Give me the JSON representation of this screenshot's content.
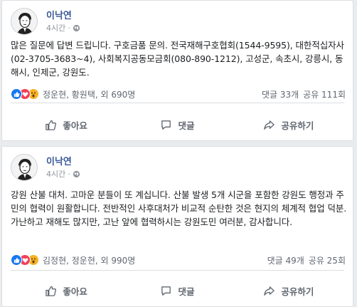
{
  "posts": [
    {
      "author": "이낙연",
      "time": "4시간",
      "text": "많은 질문에 답변 드립니다. 구호금품 문의. 전국재해구호협회(1544-9595), 대한적십자사(02-3705-3683~4), 사회복지공동모금회(080-890-1212), 고성군, 속초시, 강릉시, 동해시, 인제군, 강원도.",
      "reactors": "정운현, 황원택, 외 690명",
      "comments": "댓글 33개",
      "shares": "공유 111회"
    },
    {
      "author": "이낙연",
      "time": "4시간",
      "text": "강원 산불 대처. 고마운 분들이 또 계십니다. 산불 발생 5개 시군을 포함한 강원도 행정과 주민의 협력이 원활합니다. 전반적인 사후대처가 비교적 순탄한 것은 현지의 체계적 협업 덕분. 가난하고 재해도 많지만, 고난 앞에 협력하시는 강원도민 여러분, 감사합니다.",
      "reactors": "김정현, 정운현, 외 990명",
      "comments": "댓글 49개",
      "shares": "공유 25회"
    }
  ],
  "actions": {
    "like": "좋아요",
    "comment": "댓글",
    "share": "공유하기"
  },
  "icons": {
    "reactions": [
      "like-icon",
      "love-icon",
      "wow-icon"
    ],
    "privacy": "globe-icon",
    "like_button": "thumbs-up-icon",
    "comment_button": "speech-bubble-icon",
    "share_button": "share-arrow-icon"
  },
  "colors": {
    "author": "#385898",
    "like": "#1877f2",
    "love": "#f33e58",
    "wow": "#f7b125"
  }
}
